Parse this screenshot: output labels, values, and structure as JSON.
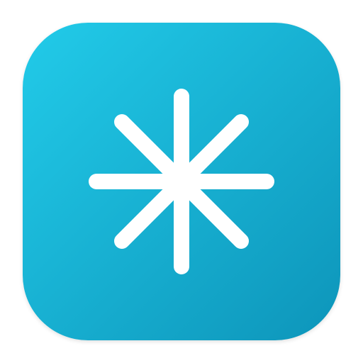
{
  "app_icon": {
    "name": "asterisk-icon",
    "colors": {
      "gradient_start": "#22cbe9",
      "gradient_end": "#0d95ba",
      "glyph": "#ffffff"
    }
  }
}
